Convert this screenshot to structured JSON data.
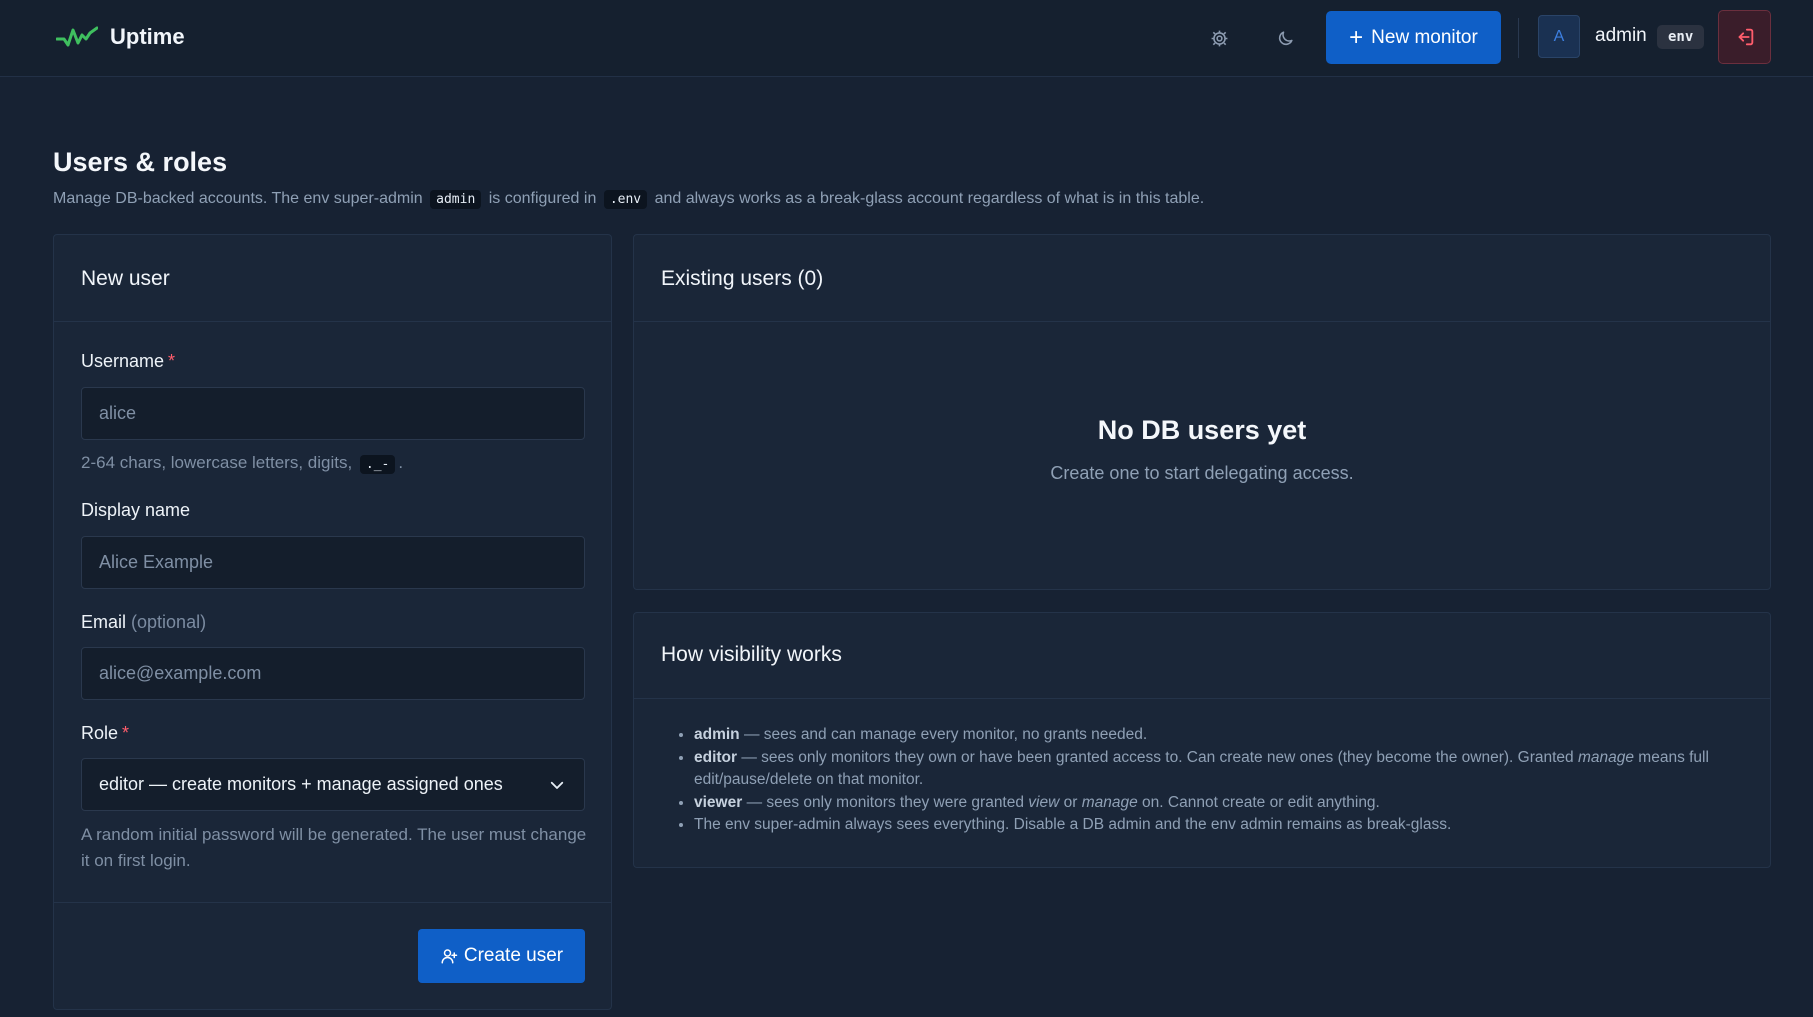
{
  "app": {
    "name": "Uptime"
  },
  "header": {
    "settings_icon": "gear-icon",
    "theme_icon": "moon-icon",
    "new_monitor_label": "New monitor",
    "avatar_initial": "A",
    "username": "admin",
    "env_badge": "env",
    "logout_icon": "logout-icon"
  },
  "page": {
    "title": "Users & roles",
    "desc_1": "Manage DB-backed accounts. The env super-admin",
    "desc_code_1": "admin",
    "desc_2": "is configured in",
    "desc_code_2": ".env",
    "desc_3": "and always works as a break-glass account regardless of what is in this table."
  },
  "new_user": {
    "title": "New user",
    "username_label": "Username",
    "username_placeholder": "alice",
    "username_hint": "2-64 chars, lowercase letters, digits,",
    "username_hint_code": "._-",
    "username_hint_end": ".",
    "display_label": "Display name",
    "display_placeholder": "Alice Example",
    "email_label": "Email",
    "email_optional": "(optional)",
    "email_placeholder": "alice@example.com",
    "role_label": "Role",
    "role_value": "editor — create monitors + manage assigned ones",
    "role_hint": "A random initial password will be generated. The user must change it on first login.",
    "required_mark": "*",
    "create_label": "Create user"
  },
  "existing": {
    "title": "Existing users (0)",
    "empty_title": "No DB users yet",
    "empty_sub": "Create one to start delegating access."
  },
  "visibility": {
    "title": "How visibility works",
    "items": [
      {
        "role": "admin",
        "text": " — sees and can manage every monitor, no grants needed."
      },
      {
        "role": "editor",
        "text_1": " — sees only monitors they own or have been granted access to. Can create new ones (they become the owner). Granted ",
        "em": "manage",
        "text_2": " means full edit/pause/delete on that monitor."
      },
      {
        "role": "viewer",
        "text_1": " — sees only monitors they were granted ",
        "em_1": "view",
        "text_2": " or ",
        "em_2": "manage",
        "text_3": " on. Cannot create or edit anything."
      },
      {
        "text": "The env super-admin always sees everything. Disable a DB admin and the env admin remains as break-glass."
      }
    ]
  },
  "colors": {
    "background": "#172233",
    "primary": "#0f5fc7",
    "danger": "#ff5d6c",
    "brand_green": "#3fbf5f"
  }
}
